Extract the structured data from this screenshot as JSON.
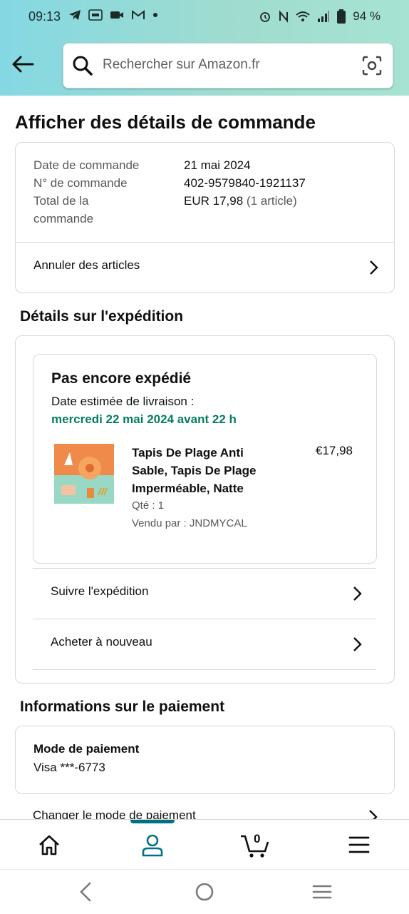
{
  "status_bar": {
    "time": "09:13",
    "battery": "94 %"
  },
  "search": {
    "placeholder": "Rechercher sur Amazon.fr"
  },
  "page_title": "Afficher des détails de commande",
  "order": {
    "date_label": "Date de commande",
    "date_value": "21 mai 2024",
    "number_label": "N° de commande",
    "number_value": "402-9579840-1921137",
    "total_label_1": "Total de la",
    "total_label_2": "commande",
    "total_value": "EUR 17,98",
    "total_count": "(1 article)",
    "cancel_label": "Annuler des articles"
  },
  "shipping": {
    "section_title": "Détails sur l'expédition",
    "status": "Pas encore expédié",
    "eta_label": "Date estimée de livraison :",
    "eta_date": "mercredi 22 mai 2024 avant 22 h",
    "item": {
      "title": "Tapis De Plage Anti Sable, Tapis De Plage Imperméable, Natte",
      "price": "€17,98",
      "quantity": "Qté : 1",
      "seller": "Vendu par : JNDMYCAL"
    },
    "track_label": "Suivre l'expédition",
    "buy_again_label": "Acheter à nouveau"
  },
  "payment": {
    "section_title": "Informations sur le paiement",
    "method_label": "Mode de paiement",
    "method_value": "Visa  ***-6773",
    "change_label": "Changer le mode de paiement"
  },
  "tabbar": {
    "cart_count": "0",
    "active_tab": "account"
  },
  "colors": {
    "accent": "#007185",
    "delivery_green": "#067D62",
    "header_start": "#84D8E3",
    "header_end": "#A6E3D2"
  }
}
